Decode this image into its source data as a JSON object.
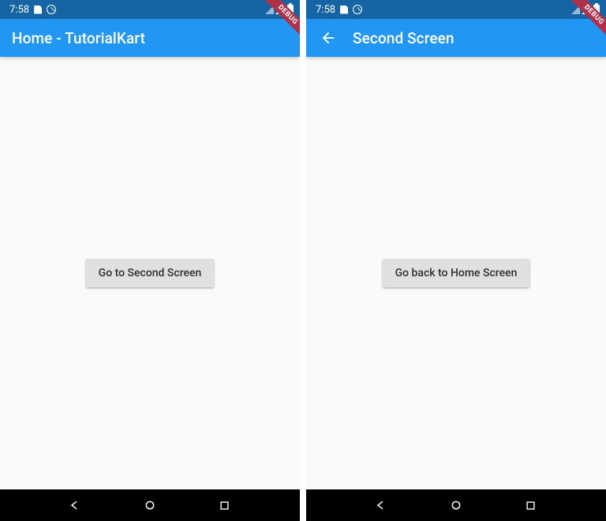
{
  "debug_banner": "DEBUG",
  "status": {
    "time": "7:58"
  },
  "screens": [
    {
      "appbar_title": "Home - TutorialKart",
      "has_back": false,
      "button_label": "Go to Second Screen"
    },
    {
      "appbar_title": "Second Screen",
      "has_back": true,
      "button_label": "Go back to Home Screen"
    }
  ]
}
